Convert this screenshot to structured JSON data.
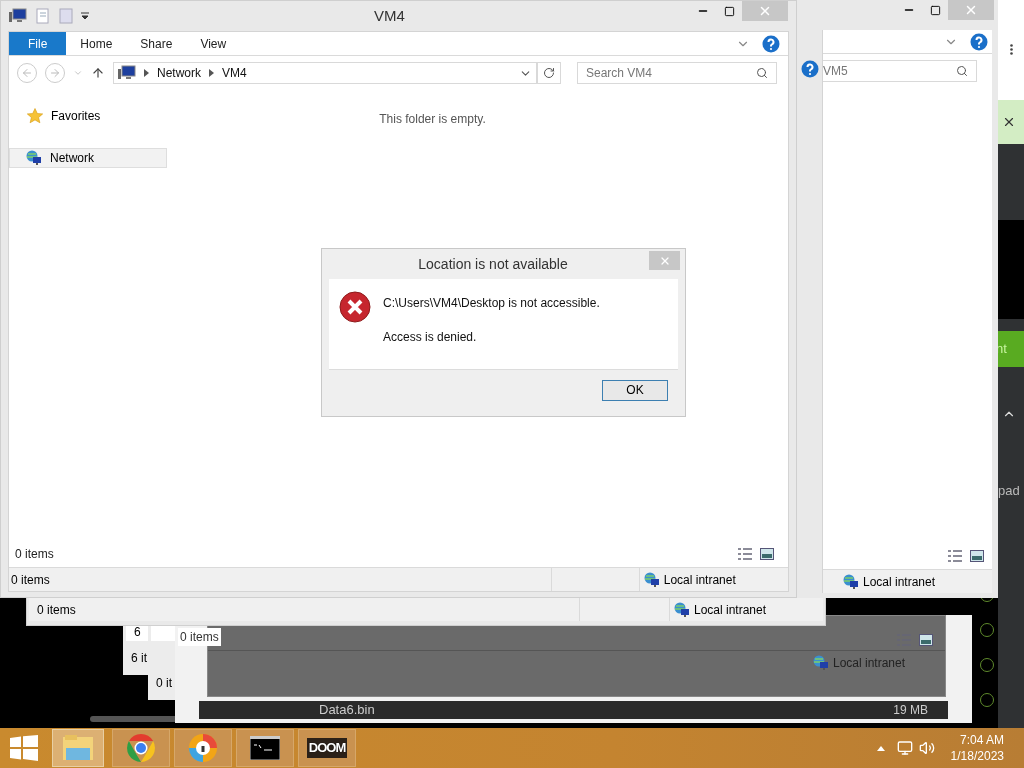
{
  "main_window": {
    "title": "VM4",
    "ribbon_tabs": [
      {
        "label": "File",
        "selected": true
      },
      {
        "label": "Home",
        "selected": false
      },
      {
        "label": "Share",
        "selected": false
      },
      {
        "label": "View",
        "selected": false
      }
    ],
    "address_path": [
      "Network",
      "VM4"
    ],
    "search": {
      "placeholder": "Search VM4"
    },
    "nav_items": [
      {
        "label": "Favorites",
        "kind": "favorites",
        "selected": false
      },
      {
        "label": "Network",
        "kind": "network",
        "selected": true
      }
    ],
    "empty_message": "This folder is empty.",
    "item_count": "0 items",
    "status_bar": {
      "items": "0 items",
      "zone": "Local intranet"
    }
  },
  "vm5_window": {
    "search": {
      "placeholder": "VM5"
    },
    "status_bar": {
      "zone": "Local intranet"
    }
  },
  "behind_window": {
    "status_bar": {
      "items": "0 items",
      "zone": "Local intranet"
    }
  },
  "small_windows": [
    {
      "top_text": "6",
      "status_text": "6 it"
    },
    {
      "status_text": "0 it"
    }
  ],
  "dark_window": {
    "item_count": "0 items",
    "status_bar": {
      "zone": "Local intranet"
    },
    "file_row": {
      "name": "Data6.bin",
      "size": "19 MB"
    }
  },
  "side_app": {
    "banner_text": "nt",
    "item_text": "pad"
  },
  "dialog": {
    "title": "Location is not available",
    "message": "C:\\Users\\VM4\\Desktop is not accessible.",
    "detail": "Access is denied.",
    "buttons": [
      "OK"
    ]
  },
  "taskbar": {
    "apps": [
      {
        "kind": "explorer",
        "selected": true
      },
      {
        "kind": "chrome",
        "selected": false
      },
      {
        "kind": "browser",
        "selected": false
      },
      {
        "kind": "terminal",
        "selected": false
      },
      {
        "kind": "doom",
        "label": "DOOM",
        "selected": false
      }
    ],
    "time": "7:04 AM",
    "date": "1/18/2023"
  }
}
